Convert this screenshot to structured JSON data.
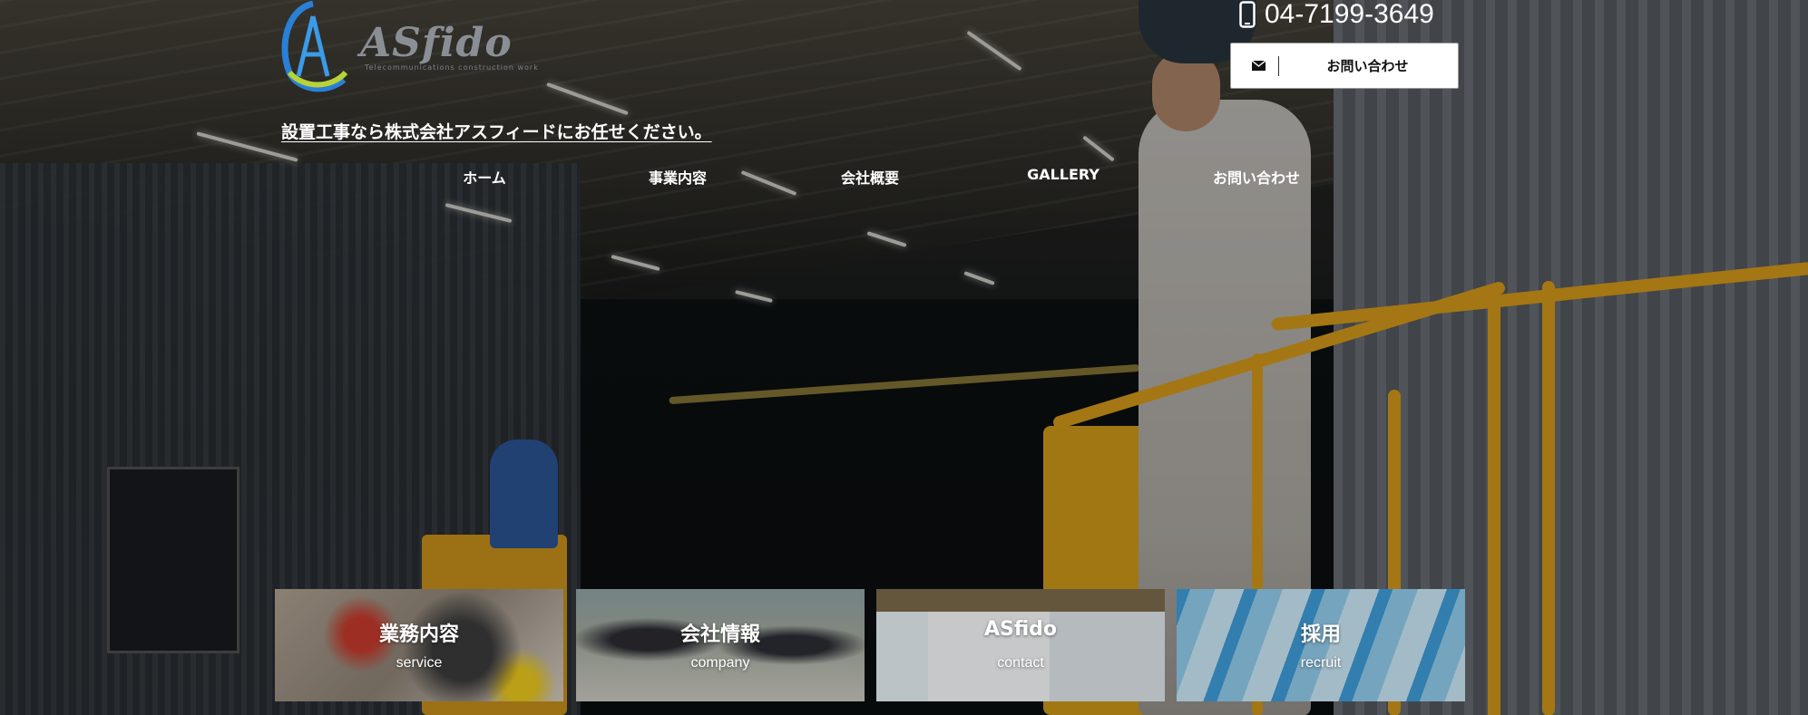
{
  "header": {
    "logo_text": "ASfido",
    "logo_subtext": "Telecommunications construction work",
    "tagline": "設置工事なら株式会社アスフィードにお任せください。",
    "phone_number": "04-7199-3649",
    "contact_button_label": "お問い合わせ"
  },
  "nav": {
    "items": [
      {
        "label": "ホーム"
      },
      {
        "label": "事業内容"
      },
      {
        "label": "会社概要"
      },
      {
        "label": "GALLERY"
      },
      {
        "label": "お問い合わせ"
      }
    ]
  },
  "tiles": [
    {
      "title": "業務内容",
      "subtitle": "service"
    },
    {
      "title": "会社情報",
      "subtitle": "company"
    },
    {
      "title": "ASfido",
      "subtitle": "contact"
    },
    {
      "title": "採用",
      "subtitle": "recruit"
    }
  ],
  "colors": {
    "accent_yellow": "#e3a51d",
    "logo_blue": "#2a7fd6",
    "logo_green": "#b8d23a",
    "text_white": "#ffffff"
  },
  "icons": {
    "phone": "phone-icon",
    "mail": "mail-icon",
    "logo": "logo-mark-icon"
  }
}
